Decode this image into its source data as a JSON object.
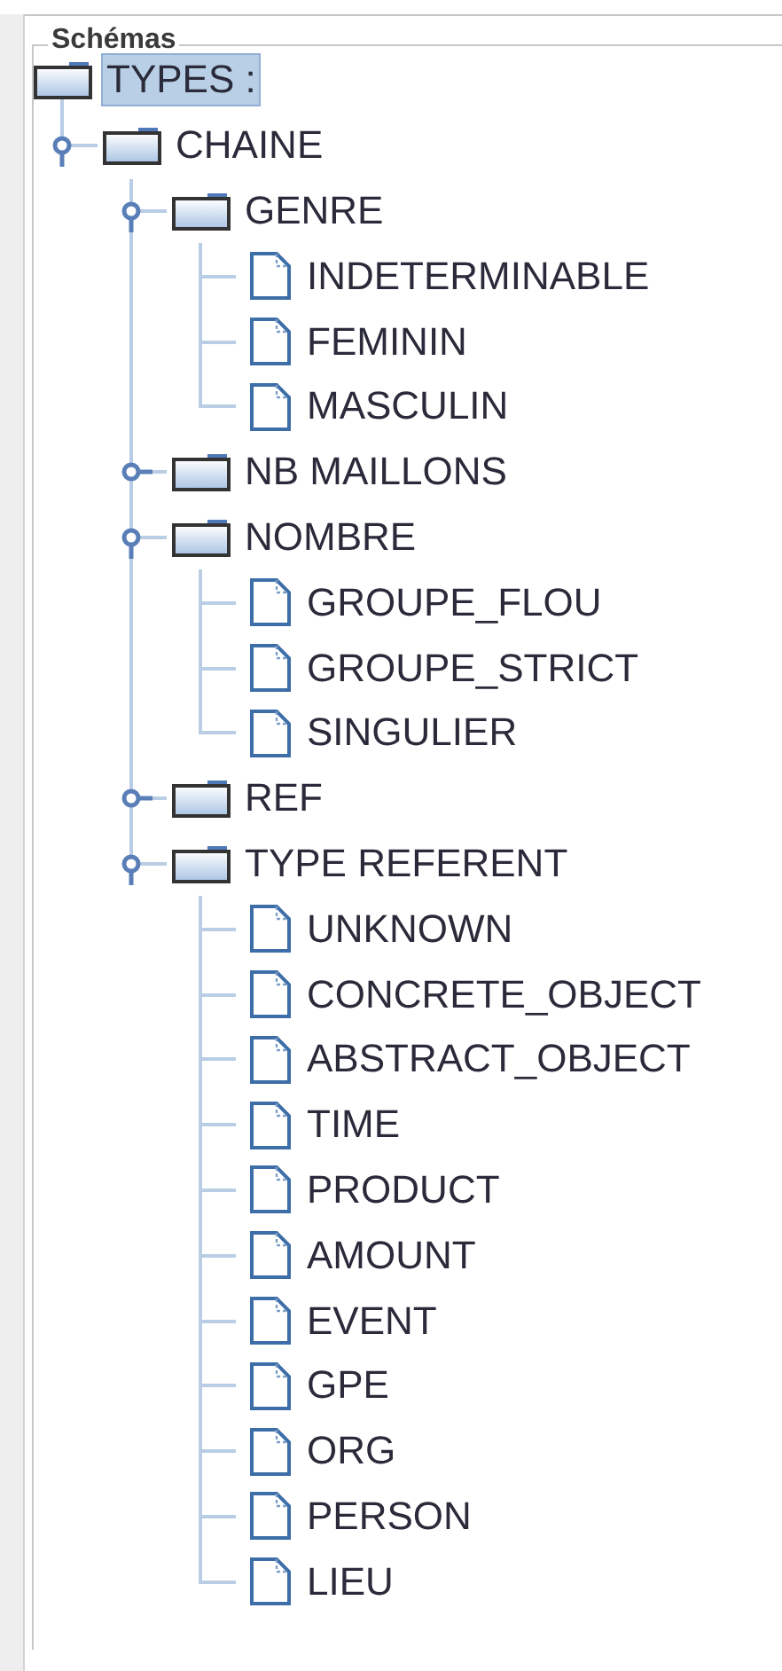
{
  "panel": {
    "title": "Schémas"
  },
  "tree": {
    "label": "TYPES :",
    "kind": "folder",
    "expanded": true,
    "selected": true,
    "children": [
      {
        "label": "CHAINE",
        "kind": "folder",
        "expanded": true,
        "selected": false,
        "children": [
          {
            "label": "GENRE",
            "kind": "folder",
            "expanded": true,
            "selected": false,
            "children": [
              {
                "label": "INDETERMINABLE",
                "kind": "leaf",
                "selected": false
              },
              {
                "label": "FEMININ",
                "kind": "leaf",
                "selected": false
              },
              {
                "label": "MASCULIN",
                "kind": "leaf",
                "selected": false
              }
            ]
          },
          {
            "label": "NB MAILLONS",
            "kind": "folder",
            "expanded": false,
            "selected": false
          },
          {
            "label": "NOMBRE",
            "kind": "folder",
            "expanded": true,
            "selected": false,
            "children": [
              {
                "label": "GROUPE_FLOU",
                "kind": "leaf",
                "selected": false
              },
              {
                "label": "GROUPE_STRICT",
                "kind": "leaf",
                "selected": false
              },
              {
                "label": "SINGULIER",
                "kind": "leaf",
                "selected": false
              }
            ]
          },
          {
            "label": "REF",
            "kind": "folder",
            "expanded": false,
            "selected": false
          },
          {
            "label": "TYPE REFERENT",
            "kind": "folder",
            "expanded": true,
            "selected": false,
            "children": [
              {
                "label": "UNKNOWN",
                "kind": "leaf",
                "selected": false
              },
              {
                "label": "CONCRETE_OBJECT",
                "kind": "leaf",
                "selected": false
              },
              {
                "label": "ABSTRACT_OBJECT",
                "kind": "leaf",
                "selected": false
              },
              {
                "label": "TIME",
                "kind": "leaf",
                "selected": false
              },
              {
                "label": "PRODUCT",
                "kind": "leaf",
                "selected": false
              },
              {
                "label": "AMOUNT",
                "kind": "leaf",
                "selected": false
              },
              {
                "label": "EVENT",
                "kind": "leaf",
                "selected": false
              },
              {
                "label": "GPE",
                "kind": "leaf",
                "selected": false
              },
              {
                "label": "ORG",
                "kind": "leaf",
                "selected": false
              },
              {
                "label": "PERSON",
                "kind": "leaf",
                "selected": false
              },
              {
                "label": "LIEU",
                "kind": "leaf",
                "selected": false
              }
            ]
          }
        ]
      }
    ]
  }
}
